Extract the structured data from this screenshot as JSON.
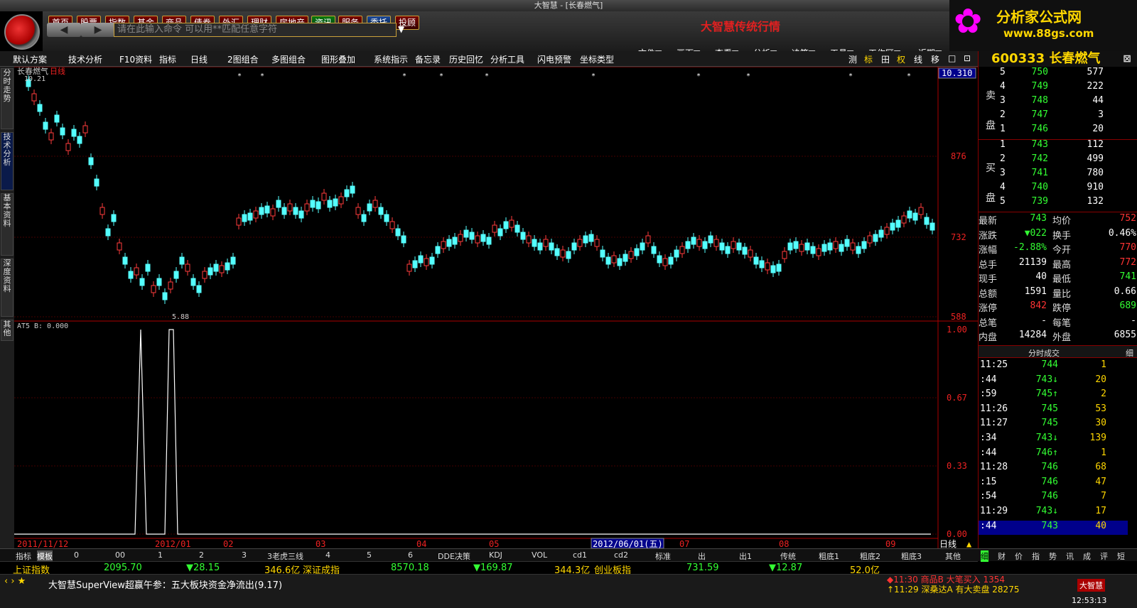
{
  "window": {
    "title": "大智慧 - [长春燃气]"
  },
  "brand": {
    "name": "大智慧传统行情"
  },
  "promo": {
    "line1": "分析家公式网",
    "line2": "www.88gs.com"
  },
  "nav": [
    "首页",
    "股票",
    "指数",
    "基金",
    "商品",
    "债券",
    "外汇",
    "理财",
    "房地产",
    "资讯",
    "服务",
    "委托",
    "投顾"
  ],
  "cmd": {
    "placeholder": "请在此输入命令   可以用**匹配任意字符"
  },
  "menu": [
    "文件▼",
    "画面▼",
    "查看▼",
    "分析▼",
    "决策▼",
    "工具▼",
    "工作区▼",
    "近期▼",
    "常用▼",
    "终端",
    "帮助"
  ],
  "toolbar": [
    "默认方案",
    "技术分析",
    "F10资料",
    "指标",
    "日线",
    "2图组合",
    "多图组合",
    "图形叠加",
    "系统指示",
    "备忘录",
    "历史回忆",
    "分析工具",
    "闪电预警",
    "坐标类型"
  ],
  "toolbar_right": [
    "测",
    "标",
    "田",
    "权",
    "线",
    "移",
    "□",
    "⊡"
  ],
  "sidetabs": [
    "分时走势",
    "技术分析",
    "基本资料",
    "深度资料",
    "其他"
  ],
  "main_chart": {
    "title": "长春燃气",
    "period": "日线",
    "high_label": "10.21",
    "low_label": "5.88",
    "price_axis": [
      "10.310",
      "876",
      "732",
      "588"
    ],
    "ind_name": "AT5",
    "ind_value": "B: 0.000",
    "ind_axis": [
      "1.00",
      "0.67",
      "0.33",
      "0.00"
    ],
    "dates": [
      "2011/11/12",
      "2012/01",
      "02",
      "03",
      "04",
      "05",
      "2012/06/01(五)",
      "07",
      "08",
      "09"
    ],
    "period_label": "日线"
  },
  "chart_data": {
    "type": "candlestick",
    "title": "长春燃气",
    "ylim": [
      5.88,
      10.31
    ],
    "indicator": {
      "name": "AT5",
      "peaks": [
        1,
        1
      ],
      "peak_months": [
        "2012/01",
        "2012/01"
      ]
    }
  },
  "quote": {
    "code": "600333",
    "name": "长春燃气",
    "sell_label": "卖盘",
    "buy_label": "买盘",
    "sell": [
      [
        "5",
        "750",
        "577"
      ],
      [
        "4",
        "749",
        "222"
      ],
      [
        "3",
        "748",
        "44"
      ],
      [
        "2",
        "747",
        "3"
      ],
      [
        "1",
        "746",
        "20"
      ]
    ],
    "buy": [
      [
        "1",
        "743",
        "112"
      ],
      [
        "2",
        "742",
        "499"
      ],
      [
        "3",
        "741",
        "780"
      ],
      [
        "4",
        "740",
        "910"
      ],
      [
        "5",
        "739",
        "132"
      ]
    ],
    "stats": [
      [
        "最新",
        "743",
        "均价",
        "752"
      ],
      [
        "涨跌",
        "▼022",
        "换手",
        "0.46%"
      ],
      [
        "涨幅",
        "-2.88%",
        "今开",
        "770"
      ],
      [
        "总手",
        "21139",
        "最高",
        "772"
      ],
      [
        "现手",
        "40",
        "最低",
        "741"
      ],
      [
        "总额",
        "1591",
        "量比",
        "0.66"
      ],
      [
        "涨停",
        "842",
        "跌停",
        "689"
      ],
      [
        "总笔",
        "-",
        "每笔",
        "-"
      ],
      [
        "内盘",
        "14284",
        "外盘",
        "6855"
      ]
    ],
    "ticks_title": "分时成交",
    "ticks_tab": "细",
    "ticks": [
      [
        "11:25",
        "744",
        "1"
      ],
      [
        ":44",
        "743↓",
        "20"
      ],
      [
        ":59",
        "745↑",
        "2"
      ],
      [
        "11:26",
        "745",
        "53"
      ],
      [
        "11:27",
        "745",
        "30"
      ],
      [
        ":34",
        "743↓",
        "139"
      ],
      [
        ":44",
        "746↑",
        "1"
      ],
      [
        "11:28",
        "746",
        "68"
      ],
      [
        ":15",
        "746",
        "47"
      ],
      [
        ":54",
        "746",
        "7"
      ],
      [
        "11:29",
        "743↓",
        "17"
      ],
      [
        ":44",
        "743",
        "40"
      ]
    ]
  },
  "bottom_tabs": [
    "指标",
    "模板",
    "0",
    "00",
    "1",
    "2",
    "3",
    "3老虎三线",
    "4",
    "5",
    "6",
    "DDE决策",
    "KDJ",
    "VOL",
    "cd1",
    "cd2",
    "标准",
    "出",
    "出1",
    "传统",
    "粗底1",
    "粗底2",
    "粗底3",
    "其他"
  ],
  "right_tabs": [
    "细",
    "财",
    "价",
    "指",
    "势",
    "讯",
    "成",
    "评",
    "短"
  ],
  "index_bar": [
    {
      "name": "上证指数",
      "value": "2095.70",
      "change": "▼28.15",
      "amount": "346.6亿"
    },
    {
      "name": "深证成指",
      "value": "8570.18",
      "change": "▼169.87",
      "amount": "344.3亿"
    },
    {
      "name": "创业板指",
      "value": "731.59",
      "change": "▼12.87",
      "amount": "52.0亿"
    }
  ],
  "news": {
    "text": "大智慧SuperView超赢午参：五大板块资金净流出(9.17)"
  },
  "alerts": [
    "◆11:30 商品B    大笔买入 1354",
    "↑11:29 深桑达A 有大卖盘 28275"
  ],
  "clock": "12:53:13",
  "bottom_logo": "大智慧"
}
